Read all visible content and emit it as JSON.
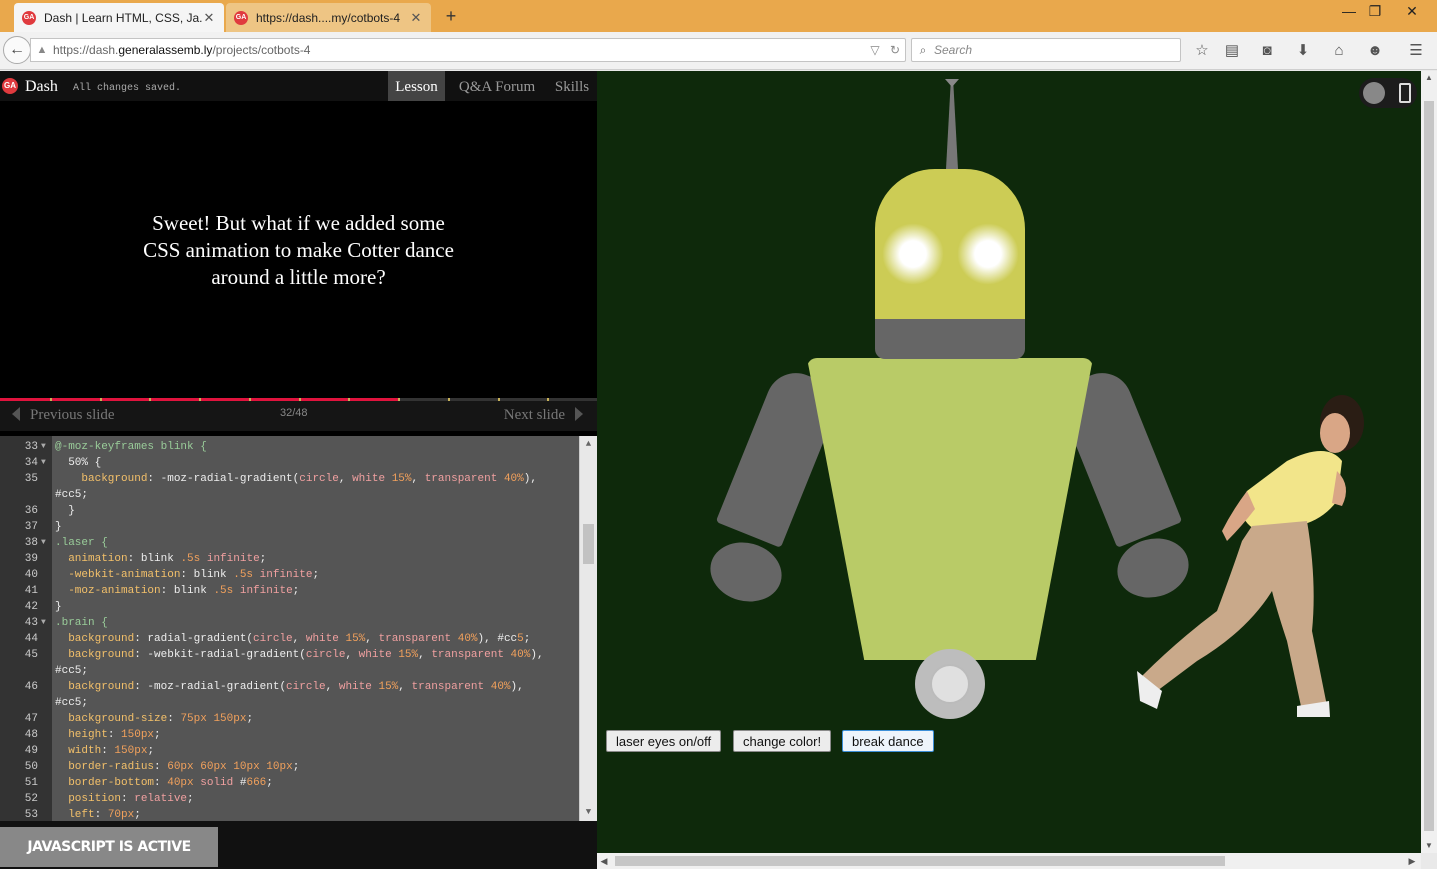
{
  "browser": {
    "tabs": [
      {
        "title": "Dash | Learn HTML, CSS, Ja...",
        "active": true
      },
      {
        "title": "https://dash....my/cotbots-4",
        "active": false
      }
    ],
    "url_prefix": "https://dash.",
    "url_domain": "generalassemb.ly",
    "url_path": "/projects/cotbots-4",
    "search_placeholder": "Search",
    "favicon_text": "GA",
    "icons": [
      "back-arrow-icon",
      "info-icon",
      "reload-icon",
      "search-icon",
      "bookmark-star-icon",
      "reading-list-icon",
      "pocket-icon",
      "download-icon",
      "home-icon",
      "hello-icon",
      "menu-icon"
    ]
  },
  "dash": {
    "logo_text": "GA",
    "title": "Dash",
    "save_status": "All changes saved.",
    "tabs": [
      "Lesson",
      "Q&A Forum",
      "Skills"
    ],
    "active_tab": "Lesson",
    "slide_text": "Sweet! But what if we added some CSS animation to make Cotter dance around a little more?",
    "prev_label": "Previous slide",
    "next_label": "Next slide",
    "slide_counter": "32/48",
    "progress": {
      "current": 32,
      "total": 48
    },
    "status_badge": "JAVASCRIPT IS ACTIVE"
  },
  "code": {
    "lines": [
      {
        "n": "33",
        "fold": true,
        "text": "@-moz-keyframes blink {"
      },
      {
        "n": "34",
        "fold": true,
        "text": "  50% {"
      },
      {
        "n": "35",
        "fold": false,
        "text": "    background: -moz-radial-gradient(circle, white 15%, transparent 40%),"
      },
      {
        "n": "",
        "fold": false,
        "text": "#cc5;"
      },
      {
        "n": "36",
        "fold": false,
        "text": "  }"
      },
      {
        "n": "37",
        "fold": false,
        "text": "}"
      },
      {
        "n": "38",
        "fold": true,
        "text": ".laser {"
      },
      {
        "n": "39",
        "fold": false,
        "text": "  animation: blink .5s infinite;"
      },
      {
        "n": "40",
        "fold": false,
        "text": "  -webkit-animation: blink .5s infinite;"
      },
      {
        "n": "41",
        "fold": false,
        "text": "  -moz-animation: blink .5s infinite;"
      },
      {
        "n": "42",
        "fold": false,
        "text": "}"
      },
      {
        "n": "43",
        "fold": true,
        "text": ".brain {"
      },
      {
        "n": "44",
        "fold": false,
        "text": "  background: radial-gradient(circle, white 15%, transparent 40%), #cc5;"
      },
      {
        "n": "45",
        "fold": false,
        "text": "  background: -webkit-radial-gradient(circle, white 15%, transparent 40%),"
      },
      {
        "n": "",
        "fold": false,
        "text": "#cc5;"
      },
      {
        "n": "46",
        "fold": false,
        "text": "  background: -moz-radial-gradient(circle, white 15%, transparent 40%),"
      },
      {
        "n": "",
        "fold": false,
        "text": "#cc5;"
      },
      {
        "n": "47",
        "fold": false,
        "text": "  background-size: 75px 150px;"
      },
      {
        "n": "48",
        "fold": false,
        "text": "  height: 150px;"
      },
      {
        "n": "49",
        "fold": false,
        "text": "  width: 150px;"
      },
      {
        "n": "50",
        "fold": false,
        "text": "  border-radius: 60px 60px 10px 10px;"
      },
      {
        "n": "51",
        "fold": false,
        "text": "  border-bottom: 40px solid #666;"
      },
      {
        "n": "52",
        "fold": false,
        "text": "  position: relative;"
      },
      {
        "n": "53",
        "fold": false,
        "text": "  left: 70px;"
      }
    ]
  },
  "preview": {
    "buttons": [
      "laser eyes on/off",
      "change color!",
      "break dance"
    ],
    "focused_button": "break dance",
    "colors": {
      "background": "#0e290b",
      "robot_head": "#cccc55",
      "robot_body": "#b9cb67",
      "robot_gray": "#666666"
    }
  }
}
